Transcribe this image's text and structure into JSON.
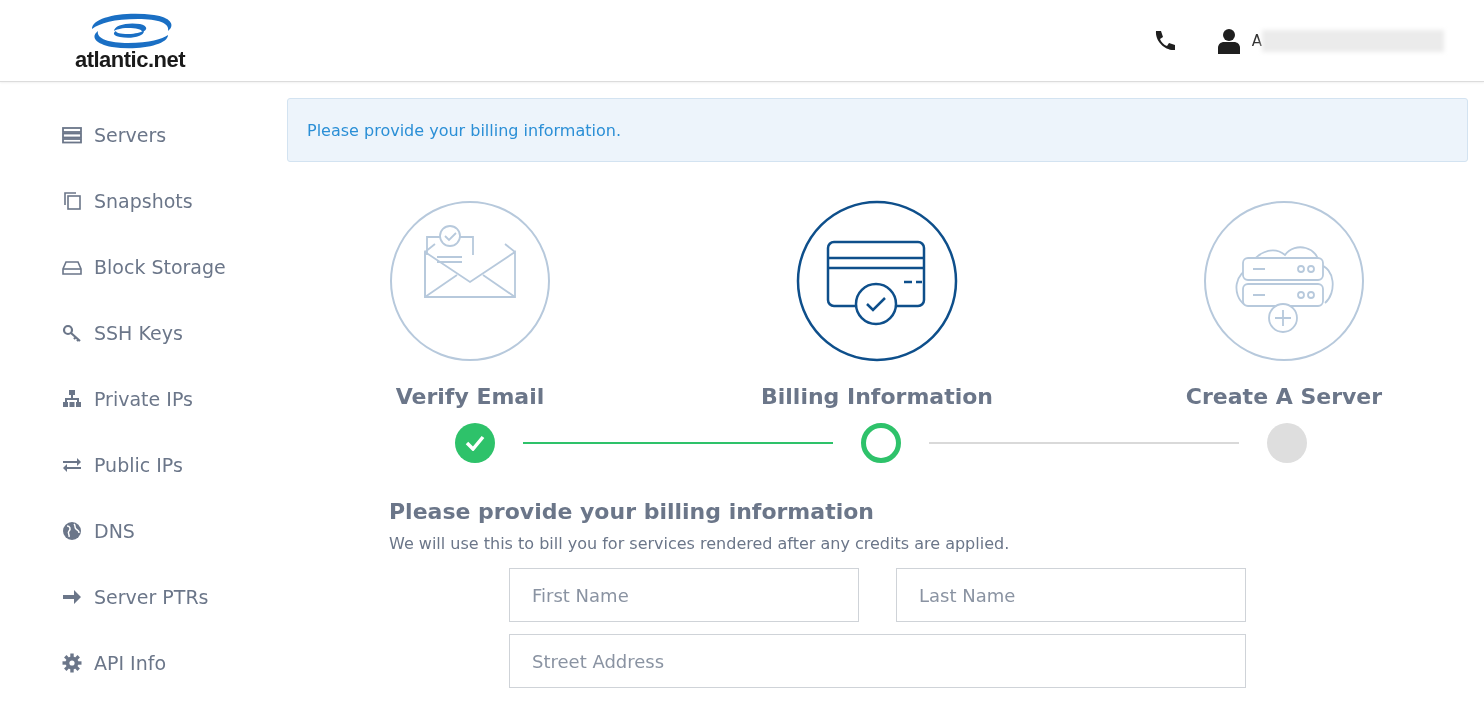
{
  "header": {
    "logo": "atlantic.net",
    "user_name": "A"
  },
  "sidebar": {
    "items": [
      {
        "label": "Servers"
      },
      {
        "label": "Snapshots"
      },
      {
        "label": "Block Storage"
      },
      {
        "label": "SSH Keys"
      },
      {
        "label": "Private IPs"
      },
      {
        "label": "Public IPs"
      },
      {
        "label": "DNS"
      },
      {
        "label": "Server PTRs"
      },
      {
        "label": "API Info"
      }
    ]
  },
  "alert": "Please provide your billing information.",
  "steps": [
    {
      "label": "Verify Email",
      "completed": true,
      "selected": false
    },
    {
      "label": "Billing Information",
      "completed": false,
      "selected": true
    },
    {
      "label": "Create A Server",
      "completed": false,
      "selected": false
    }
  ],
  "form": {
    "title": "Please provide your billing information",
    "subtitle": "We will use this to bill you for services rendered after any credits are applied.",
    "rows": [
      [
        {
          "placeholder": "First Name"
        },
        {
          "placeholder": "Last Name"
        }
      ],
      [
        {
          "placeholder": "Street Address"
        }
      ]
    ]
  }
}
